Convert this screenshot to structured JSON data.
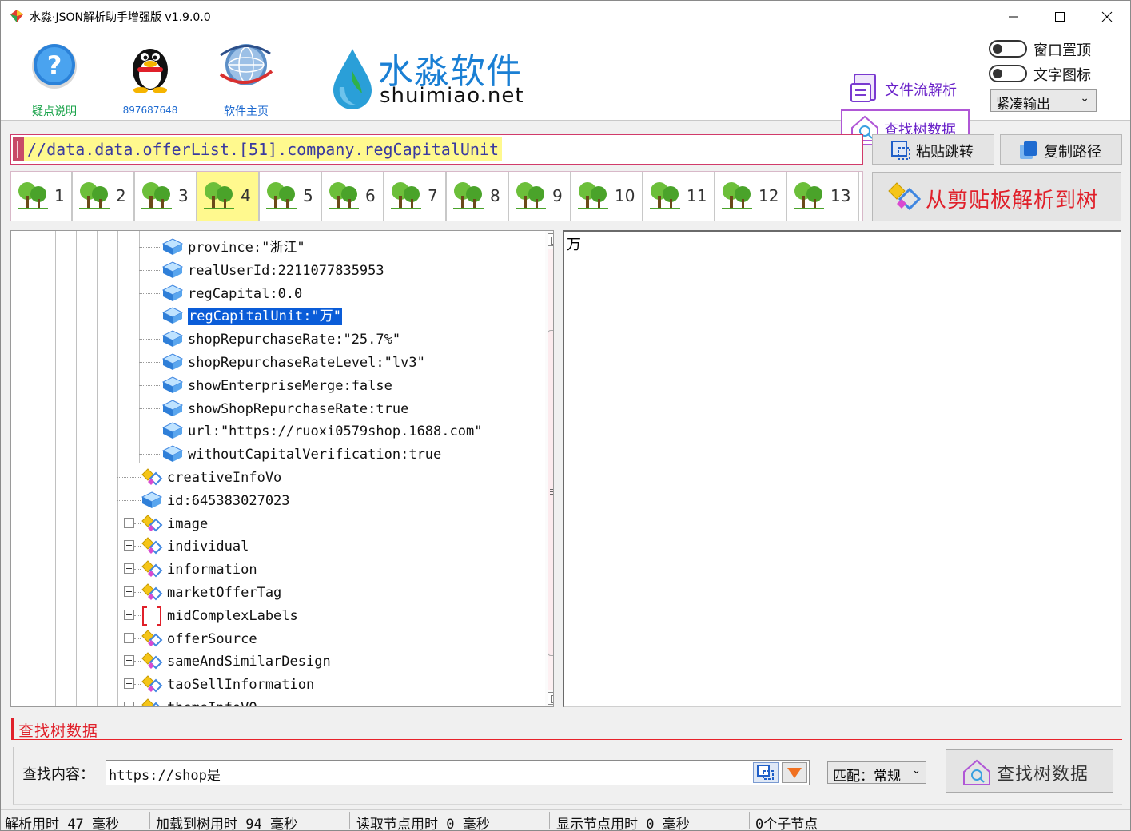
{
  "window": {
    "title": "水淼·JSON解析助手增强版 v1.9.0.0"
  },
  "header": {
    "help_label": "疑点说明",
    "qq_label": "897687648",
    "homepage_label": "软件主页",
    "brand_cn": "水淼软件",
    "brand_en": "shuimiao.net",
    "file_stream_label": "文件流解析",
    "find_tree_label": "查找树数据",
    "toggle_topmost_label": "窗口置顶",
    "toggle_text_icon_label": "文字图标",
    "output_mode": "紧凑输出"
  },
  "pathbar": {
    "path": "//data.data.offerList.[51].company.regCapitalUnit",
    "paste_jump_label": "粘贴跳转",
    "copy_path_label": "复制路径"
  },
  "tabs": [
    "1",
    "2",
    "3",
    "4",
    "5",
    "6",
    "7",
    "8",
    "9",
    "10",
    "11",
    "12",
    "13"
  ],
  "active_tab": "4",
  "parse_clipboard_label": "从剪贴板解析到树",
  "tree": {
    "leaf_nodes": [
      "province:\"浙江\"",
      "realUserId:2211077835953",
      "regCapital:0.0",
      "regCapitalUnit:\"万\"",
      "shopRepurchaseRate:\"25.7%\"",
      "shopRepurchaseRateLevel:\"lv3\"",
      "showEnterpriseMerge:false",
      "showShopRepurchaseRate:true",
      "url:\"https://ruoxi0579shop.1688.com\"",
      "withoutCapitalVerification:true"
    ],
    "selected_node": "regCapitalUnit:\"万\"",
    "parent_nodes": [
      "creativeInfoVo",
      "id:645383027023",
      "image",
      "individual",
      "information",
      "marketOfferTag",
      "midComplexLabels",
      "offerSource",
      "sameAndSimilarDesign",
      "taoSellInformation",
      "themeInfoVO"
    ]
  },
  "value_panel": {
    "text": "万"
  },
  "find": {
    "section_title": "查找树数据",
    "content_label": "查找内容：",
    "query": "https://shop是",
    "match_mode": "匹配：常规",
    "button_label": "查找树数据"
  },
  "status": {
    "parse_time": "解析用时 47 毫秒",
    "load_time": "加载到树用时 94 毫秒",
    "read_time": "读取节点用时 0 毫秒",
    "display_time": "显示节点用时 0 毫秒",
    "child_count": "0个子节点"
  },
  "colors": {
    "accent_red": "#e0202a",
    "accent_purple": "#6a22c9",
    "path_highlight": "#fff98e",
    "selection_blue": "#0a5cd8",
    "brand_blue": "#1a7fd4",
    "help_green": "#1aa34a"
  },
  "icons": {
    "tree_leaf": "cube-icon",
    "tree_object": "object-brace-icon",
    "tree_array": "array-bracket-icon",
    "tab": "tree-icon"
  }
}
